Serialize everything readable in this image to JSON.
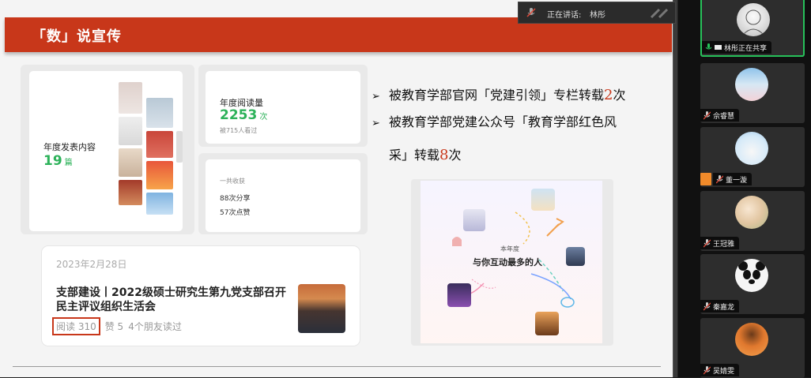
{
  "slide": {
    "banner_title": "「数」说宣传",
    "annual_posts_label": "年度发表内容",
    "annual_posts_value": "19",
    "annual_posts_unit": "篇",
    "annual_reads_label": "年度阅读量",
    "annual_reads_value": "2253",
    "annual_reads_unit": "次",
    "annual_reads_sub": "被715人看过",
    "total_gain_label": "一共收获",
    "shares": "88次分享",
    "likes": "57次点赞",
    "bullets": [
      {
        "prefix": "被教育学部官网「党建引领」专栏转载",
        "count": "2",
        "suffix": "次"
      },
      {
        "prefix": "被教育学部党建公众号「教育学部红色风",
        "count": "",
        "suffix": ""
      },
      {
        "prefix": "采」转载",
        "count": "8",
        "suffix": "次"
      }
    ],
    "post": {
      "date": "2023年2月28日",
      "title": "支部建设丨2022级硕士研究生第九党支部召开民主评议组织生活会",
      "reads": "阅读 310",
      "likes": "赞 5",
      "friends": "4个朋友读过"
    },
    "interaction": {
      "subtitle": "本年度",
      "title": "与你互动最多的人"
    }
  },
  "speaking": {
    "label": "正在讲话:",
    "name": "林彤"
  },
  "participants": [
    {
      "name": "林彤正在共享",
      "active": true,
      "mic": "on",
      "avatar": "sketch-portrait"
    },
    {
      "name": "佘睿慧",
      "active": false,
      "mic": "muted",
      "avatar": "blossom"
    },
    {
      "name": "董一漩",
      "active": false,
      "mic": "muted",
      "avatar": "snow-character",
      "host": true
    },
    {
      "name": "王冠雅",
      "active": false,
      "mic": "muted",
      "avatar": "flowers"
    },
    {
      "name": "秦嘉龙",
      "active": false,
      "mic": "muted",
      "avatar": "panda"
    },
    {
      "name": "吴婧雯",
      "active": false,
      "mic": "muted",
      "avatar": "orange-portrait"
    }
  ],
  "colors": {
    "accent_red": "#c8371a",
    "stat_green": "#2db25a",
    "active_border": "#27c15a"
  }
}
